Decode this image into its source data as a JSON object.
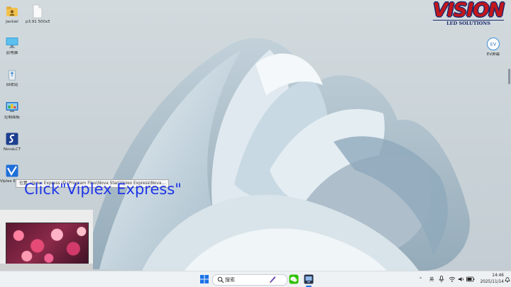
{
  "desktop": {
    "icons": [
      {
        "label": "Jackiel"
      },
      {
        "label": "p3.91 500x5..."
      },
      {
        "label": "此电脑"
      },
      {
        "label": "回收站"
      },
      {
        "label": "控制面板"
      },
      {
        "label": "NovaLCT"
      },
      {
        "label": "Viplex Express"
      }
    ],
    "right_icons": [
      {
        "label": "EV屏幕"
      }
    ]
  },
  "logo": {
    "title": "VISION",
    "subtitle": "LED SOLUTIONS"
  },
  "tooltip": {
    "text": "位置: Viplex Express (D:\\Program Files\\Nova Star\\Viplex Express\\Nova..."
  },
  "caption": {
    "text": "Click\"Viplex Express\""
  },
  "taskbar": {
    "search_placeholder": "搜索",
    "tray": {
      "language": "英",
      "time": "14:46",
      "date": "2025/11/14"
    }
  },
  "colors": {
    "caption": "#1f35e8",
    "logo_red": "#c4161c",
    "logo_navy": "#1a2a6c"
  }
}
